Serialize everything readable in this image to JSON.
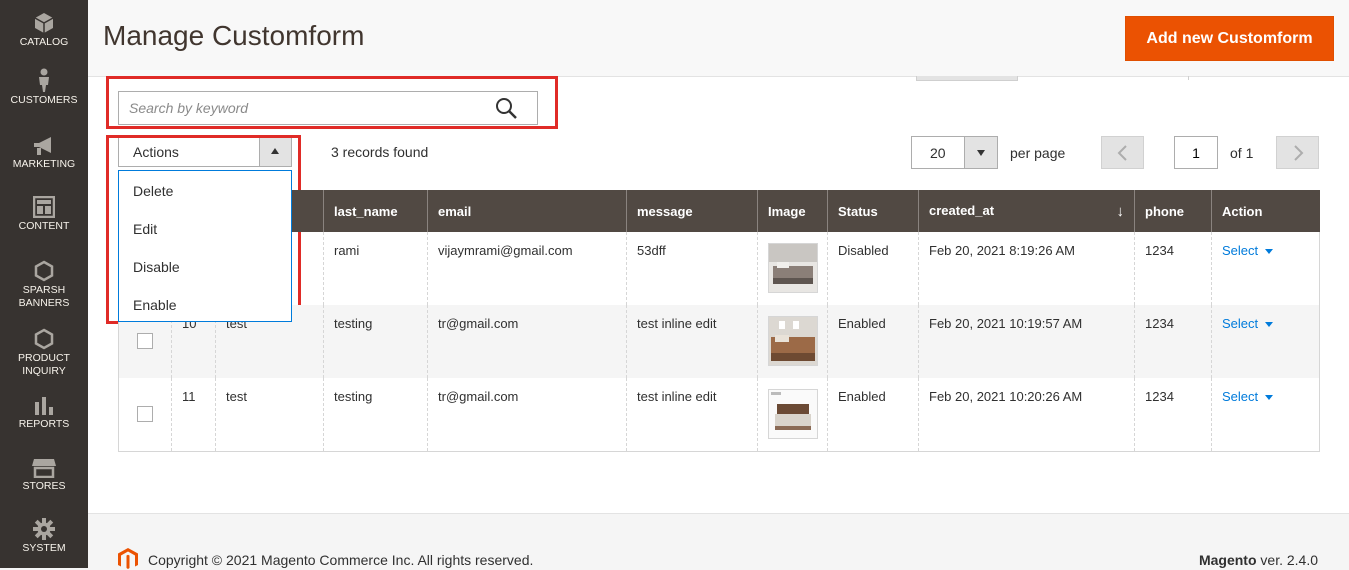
{
  "sidebar": {
    "items": [
      {
        "label": "CATALOG",
        "icon": "cube-icon"
      },
      {
        "label": "CUSTOMERS",
        "icon": "person-icon"
      },
      {
        "label": "MARKETING",
        "icon": "megaphone-icon"
      },
      {
        "label": "CONTENT",
        "icon": "layout-icon"
      },
      {
        "label": "SPARSH BANNERS",
        "icon": "hexagon-icon"
      },
      {
        "label": "PRODUCT INQUIRY",
        "icon": "hexagon-icon"
      },
      {
        "label": "REPORTS",
        "icon": "bar-chart-icon"
      },
      {
        "label": "STORES",
        "icon": "store-icon"
      },
      {
        "label": "SYSTEM",
        "icon": "gear-icon"
      }
    ]
  },
  "header": {
    "title": "Manage Customform",
    "add_button": "Add new Customform"
  },
  "search": {
    "placeholder": "Search by keyword",
    "value": ""
  },
  "actions": {
    "label": "Actions",
    "menu": [
      "Delete",
      "Edit",
      "Disable",
      "Enable"
    ]
  },
  "records_text": "3 records found",
  "pager": {
    "per_page": "20",
    "per_page_label": "per page",
    "page": "1",
    "of_text": "of 1"
  },
  "grid": {
    "columns": [
      "",
      "",
      "",
      "last_name",
      "email",
      "message",
      "Image",
      "Status",
      "created_at",
      "phone",
      "Action"
    ],
    "sort_icon": "↓",
    "rows": [
      {
        "id": "",
        "first_name": "",
        "last_name": "rami",
        "email": "vijaymrami@gmail.com",
        "message": "53dff",
        "status": "Disabled",
        "created_at": "Feb 20, 2021 8:19:26 AM",
        "phone": "1234",
        "action": "Select"
      },
      {
        "id": "10",
        "first_name": "test",
        "last_name": "testing",
        "email": "tr@gmail.com",
        "message": "test inline edit",
        "status": "Enabled",
        "created_at": "Feb 20, 2021 10:19:57 AM",
        "phone": "1234",
        "action": "Select"
      },
      {
        "id": "11",
        "first_name": "test",
        "last_name": "testing",
        "email": "tr@gmail.com",
        "message": "test inline edit",
        "status": "Enabled",
        "created_at": "Feb 20, 2021 10:20:26 AM",
        "phone": "1234",
        "action": "Select"
      }
    ]
  },
  "footer": {
    "copyright": "Copyright © 2021 Magento Commerce Inc. All rights reserved.",
    "brand": "Magento",
    "version": " ver. 2.4.0"
  },
  "colors": {
    "accent": "#eb5202",
    "sidebar": "#373330",
    "grid_header": "#514943",
    "link": "#007bdb",
    "highlight": "#e02b27"
  }
}
